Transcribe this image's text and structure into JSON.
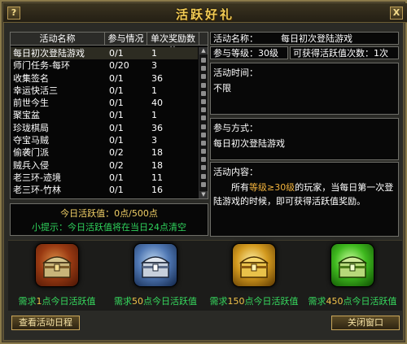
{
  "window": {
    "title": "活跃好礼",
    "help_label": "?",
    "close_label": "X"
  },
  "list": {
    "headers": [
      "活动名称",
      "参与情况",
      "单次奖励数值"
    ],
    "rows": [
      {
        "name": "每日初次登陆游戏",
        "progress": "0/1",
        "reward": "1"
      },
      {
        "name": "师门任务-每环",
        "progress": "0/20",
        "reward": "3"
      },
      {
        "name": "收集签名",
        "progress": "0/1",
        "reward": "36"
      },
      {
        "name": "幸运快活三",
        "progress": "0/1",
        "reward": "1"
      },
      {
        "name": "前世今生",
        "progress": "0/1",
        "reward": "40"
      },
      {
        "name": "聚宝盆",
        "progress": "0/1",
        "reward": "1"
      },
      {
        "name": "珍珑棋局",
        "progress": "0/1",
        "reward": "36"
      },
      {
        "name": "夺宝马贼",
        "progress": "0/1",
        "reward": "3"
      },
      {
        "name": "偷袭门派",
        "progress": "0/2",
        "reward": "18"
      },
      {
        "name": "贼兵入侵",
        "progress": "0/2",
        "reward": "18"
      },
      {
        "name": "老三环-迹境",
        "progress": "0/1",
        "reward": "11"
      },
      {
        "name": "老三环-竹林",
        "progress": "0/1",
        "reward": "16"
      }
    ]
  },
  "progress": {
    "prefix": "今日活跃值：",
    "current": "0",
    "suffix": "点/500点",
    "tip": "小提示：今日活跃值将在当日24点清空"
  },
  "detail": {
    "name_label": "活动名称：",
    "name_value": "每日初次登陆游戏",
    "level_label": "参与等级：",
    "level_value": "30级",
    "count_label": "可获得活跃值次数：",
    "count_value": "1次",
    "time_label": "活动时间：",
    "time_value": "不限",
    "method_label": "参与方式：",
    "method_value": "每日初次登陆游戏",
    "content_label": "活动内容：",
    "content_pre": "所有",
    "content_level": "等级≥30级",
    "content_post": "的玩家，当每日第一次登陆游戏的时候，即可获得活跃值奖励。"
  },
  "rewards": [
    {
      "label_pre": "需求",
      "points": "1",
      "label_post": "点今日活跃值",
      "icon": "bronze-treasure-chest-icon",
      "color": "#9a3a12"
    },
    {
      "label_pre": "需求",
      "points": "50",
      "label_post": "点今日活跃值",
      "icon": "silver-treasure-chest-icon",
      "color": "#4f77b3"
    },
    {
      "label_pre": "需求",
      "points": "150",
      "label_post": "点今日活跃值",
      "icon": "gold-treasure-chest-icon",
      "color": "#d39a1f"
    },
    {
      "label_pre": "需求",
      "points": "450",
      "label_post": "点今日活跃值",
      "icon": "jade-treasure-chest-icon",
      "color": "#3fb91f"
    }
  ],
  "buttons": {
    "schedule": "查看活动日程",
    "close": "关闭窗口"
  }
}
